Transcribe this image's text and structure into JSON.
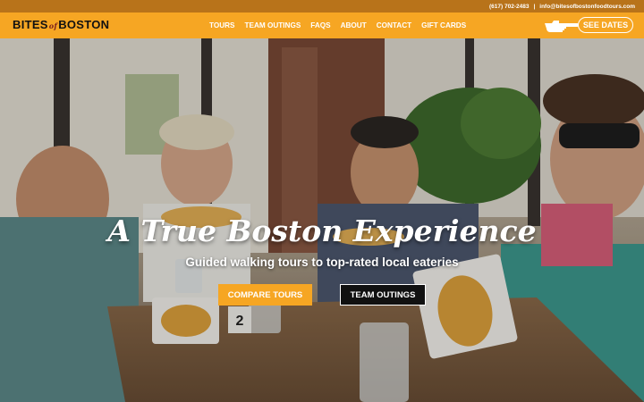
{
  "topbar": {
    "phone": "(617) 702-2483",
    "divider": "|",
    "email": "info@bitesofbostonfoodtours.com"
  },
  "brand": {
    "name_part1": "BITES",
    "name_of": "of",
    "name_part2": "BOSTON"
  },
  "nav": {
    "items": [
      "TOURS",
      "TEAM OUTINGS",
      "FAQS",
      "ABOUT",
      "CONTACT",
      "GIFT CARDS"
    ]
  },
  "cta": {
    "see_dates": "SEE DATES",
    "pointer_icon": "pointing-hand-icon"
  },
  "hero": {
    "headline": "A True Boston Experience",
    "subheadline": "Guided walking tours to top-rated local eateries",
    "compare_button": "COMPARE TOURS",
    "team_button": "TEAM OUTINGS",
    "table_number": "2"
  },
  "colors": {
    "brand_orange": "#f6a623",
    "topbar_brown": "#b8731a",
    "button_black": "#111111"
  }
}
